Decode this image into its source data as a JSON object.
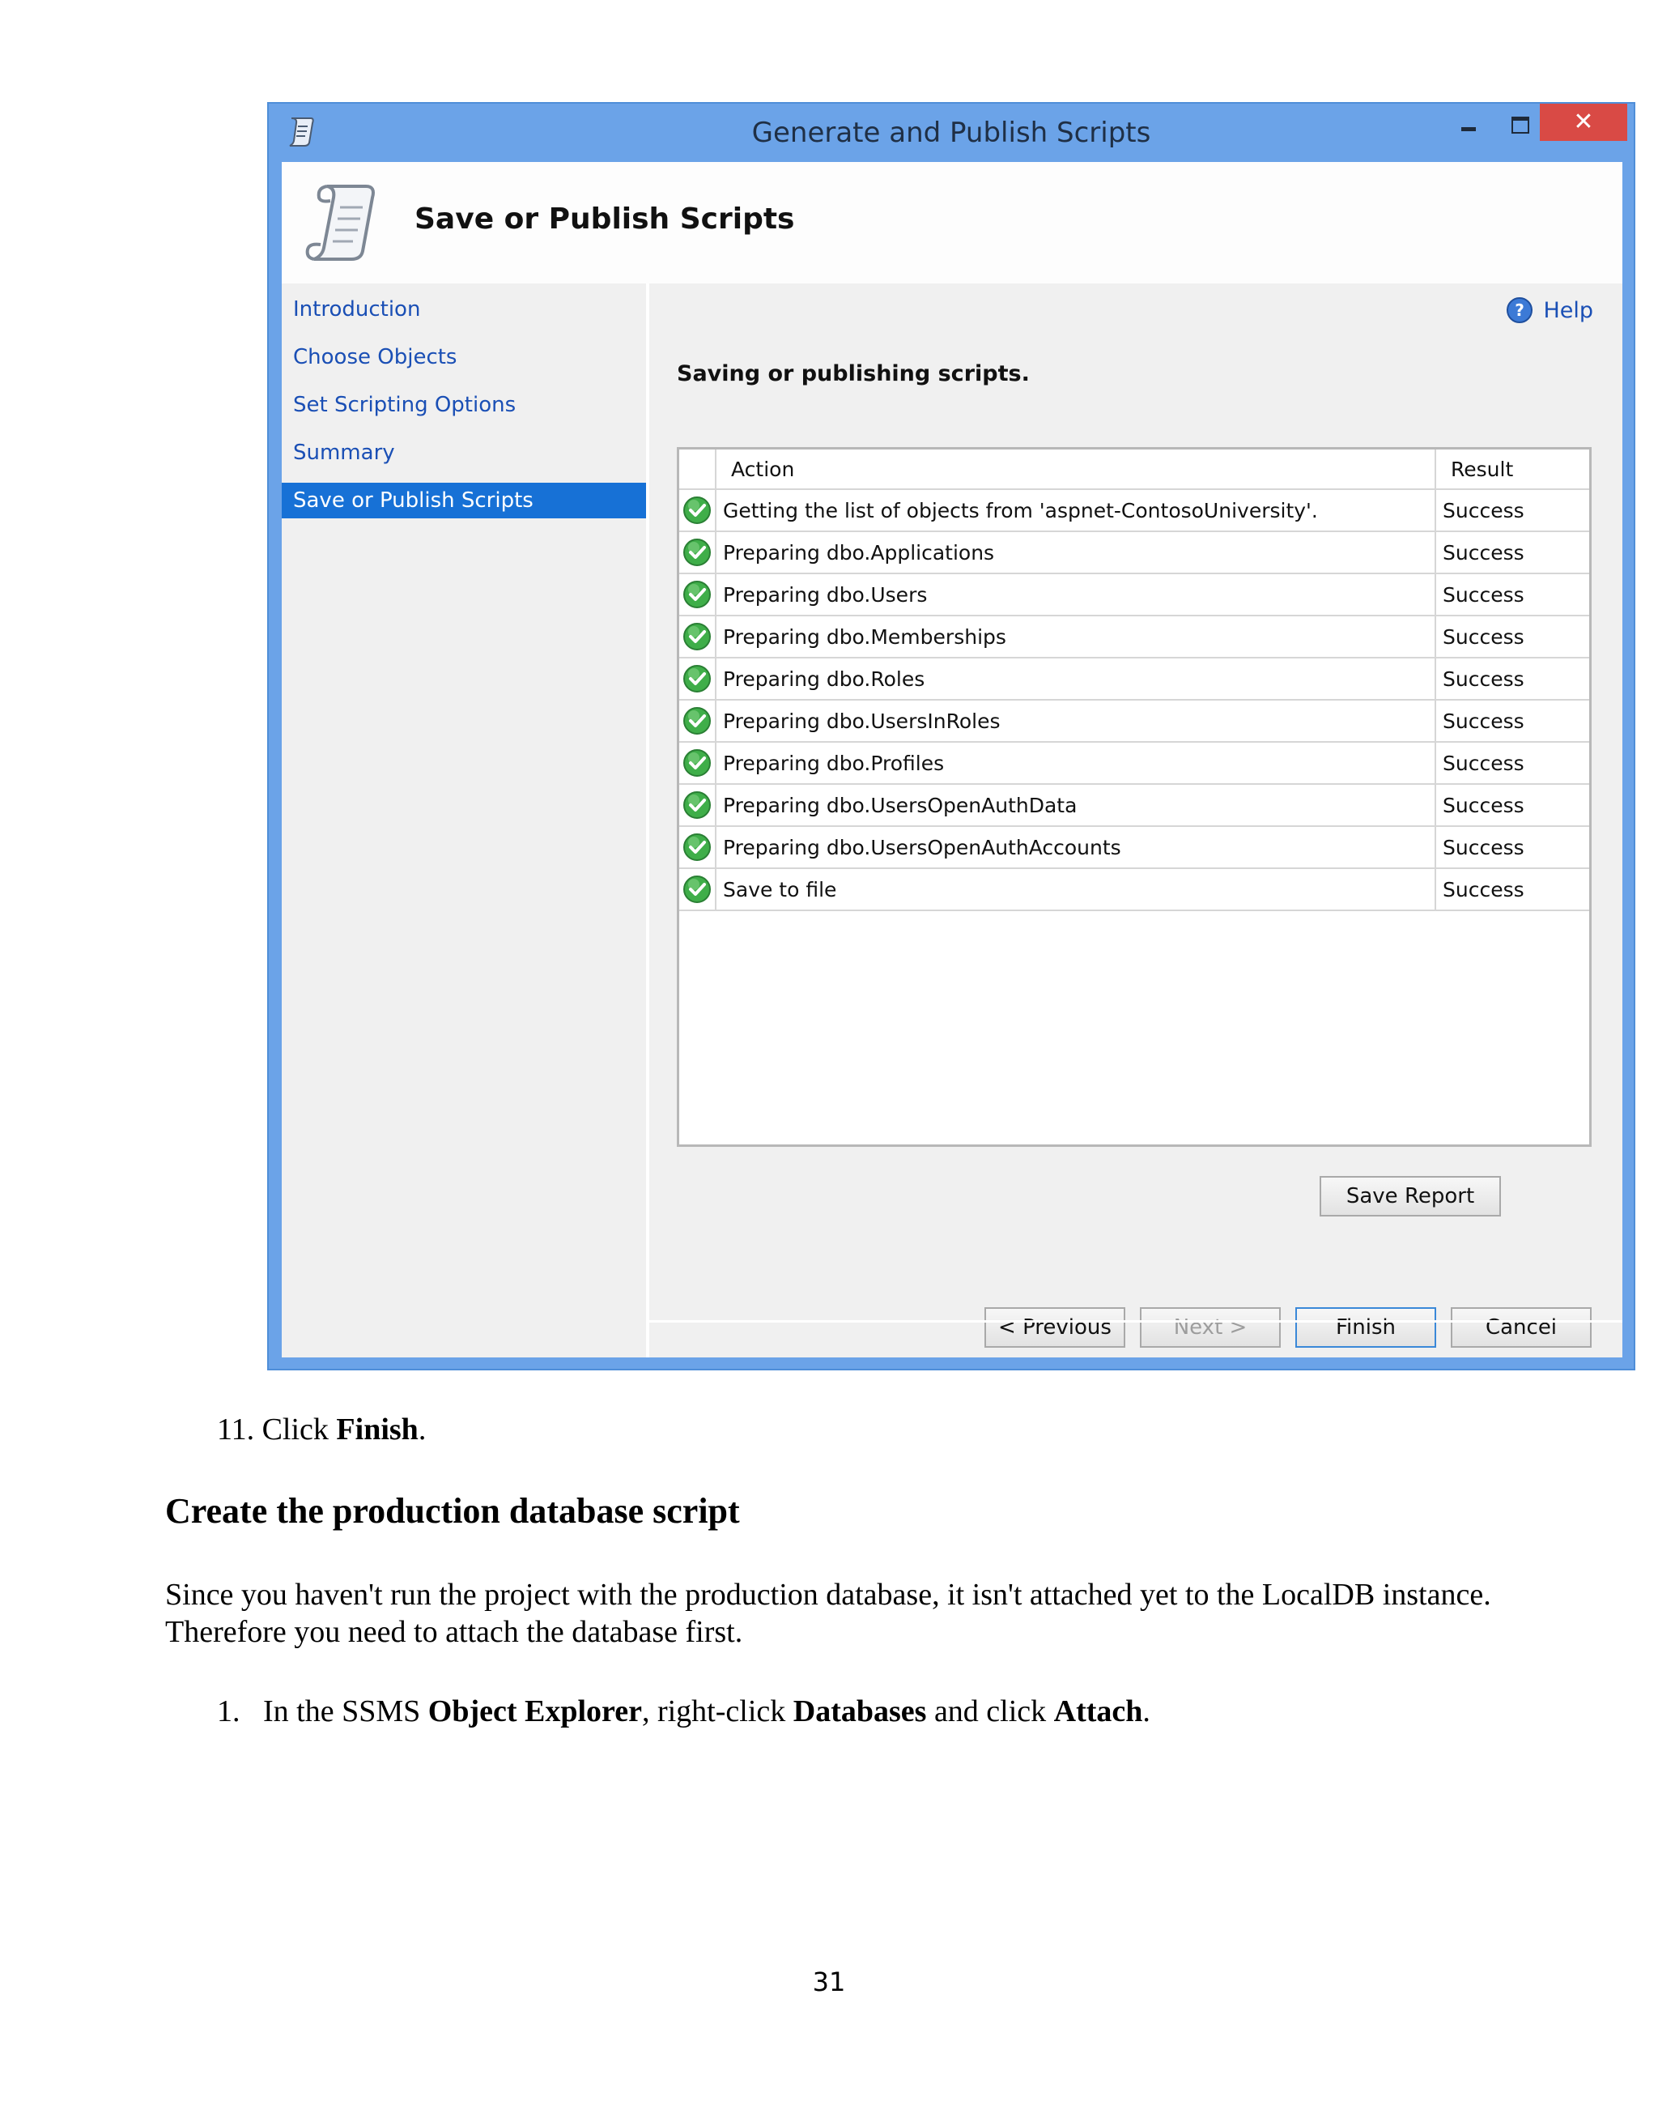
{
  "window": {
    "title": "Generate and Publish Scripts",
    "close_glyph": "✕",
    "header_title": "Save or Publish Scripts",
    "sidebar_items": [
      {
        "label": "Introduction",
        "active": false
      },
      {
        "label": "Choose Objects",
        "active": false
      },
      {
        "label": "Set Scripting Options",
        "active": false
      },
      {
        "label": "Summary",
        "active": false
      },
      {
        "label": "Save or Publish Scripts",
        "active": true
      }
    ],
    "help_label": "Help",
    "status_text": "Saving or publishing scripts.",
    "table": {
      "headers": [
        "Action",
        "Result"
      ],
      "rows": [
        {
          "action": "Getting the list of objects from 'aspnet-ContosoUniversity'.",
          "result": "Success",
          "icon": "success-check-icon"
        },
        {
          "action": "Preparing dbo.Applications",
          "result": "Success",
          "icon": "success-check-icon"
        },
        {
          "action": "Preparing dbo.Users",
          "result": "Success",
          "icon": "success-check-icon"
        },
        {
          "action": "Preparing dbo.Memberships",
          "result": "Success",
          "icon": "success-check-icon"
        },
        {
          "action": "Preparing dbo.Roles",
          "result": "Success",
          "icon": "success-check-icon"
        },
        {
          "action": "Preparing dbo.UsersInRoles",
          "result": "Success",
          "icon": "success-check-icon"
        },
        {
          "action": "Preparing dbo.Profiles",
          "result": "Success",
          "icon": "success-check-icon"
        },
        {
          "action": "Preparing dbo.UsersOpenAuthData",
          "result": "Success",
          "icon": "success-check-icon"
        },
        {
          "action": "Preparing dbo.UsersOpenAuthAccounts",
          "result": "Success",
          "icon": "success-check-icon"
        },
        {
          "action": "Save to file",
          "result": "Success",
          "icon": "success-check-icon"
        }
      ]
    },
    "buttons": {
      "save_report": "Save Report",
      "previous": "< Previous",
      "next": "Next >",
      "finish": "Finish",
      "cancel": "Cancel"
    },
    "colors": {
      "frame": "#6ba3e8",
      "close": "#d94a45",
      "active_nav": "#1771d6",
      "link": "#1a4fb5",
      "success": "#3fae49"
    }
  },
  "document": {
    "step_11": {
      "prefix": "11. Click ",
      "bold": "Finish",
      "suffix": "."
    },
    "section_heading": "Create the production database script",
    "paragraph": "Since you haven't run the project with the production database, it isn't attached yet to the LocalDB instance. Therefore you need to attach the database first.",
    "step_1": {
      "number": "1.",
      "text1": "In the SSMS ",
      "bold1": "Object Explorer",
      "text2": ", right-click ",
      "bold2": "Databases",
      "text3": " and click ",
      "bold3": "Attach",
      "text4": "."
    },
    "page_number": "31"
  }
}
